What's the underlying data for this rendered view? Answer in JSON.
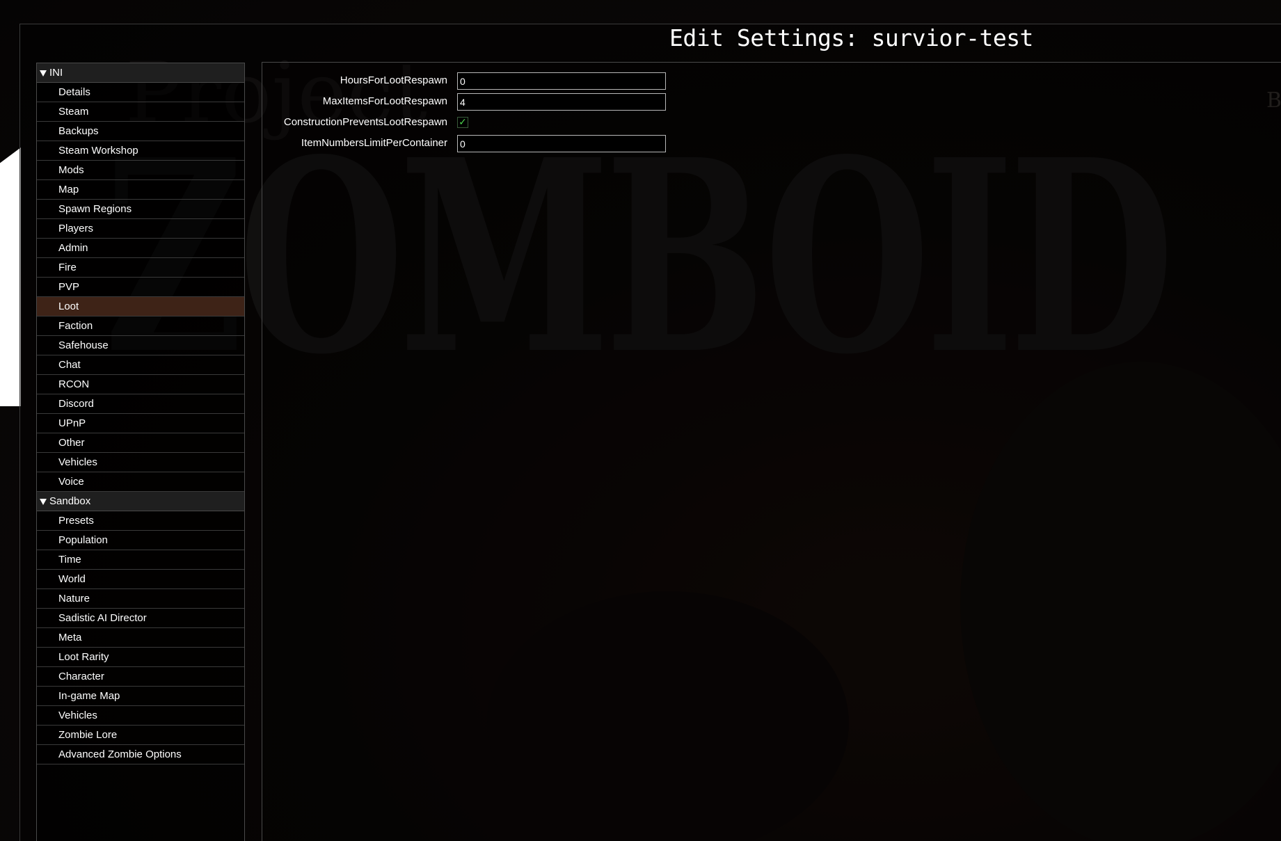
{
  "window": {
    "title": "Edit Settings: survior-test"
  },
  "background": {
    "art_sub": "Project",
    "art_title": "ZOMBOID",
    "right_fragment": "B"
  },
  "sidebar": {
    "sections": [
      {
        "label": "INI",
        "expanded": true,
        "items": [
          "Details",
          "Steam",
          "Backups",
          "Steam Workshop",
          "Mods",
          "Map",
          "Spawn Regions",
          "Players",
          "Admin",
          "Fire",
          "PVP",
          "Loot",
          "Faction",
          "Safehouse",
          "Chat",
          "RCON",
          "Discord",
          "UPnP",
          "Other",
          "Vehicles",
          "Voice"
        ]
      },
      {
        "label": "Sandbox",
        "expanded": true,
        "items": [
          "Presets",
          "Population",
          "Time",
          "World",
          "Nature",
          "Sadistic AI Director",
          "Meta",
          "Loot Rarity",
          "Character",
          "In-game Map",
          "Vehicles",
          "Zombie Lore",
          "Advanced Zombie Options"
        ]
      }
    ],
    "selected": "Loot"
  },
  "settings": [
    {
      "label": "HoursForLootRespawn",
      "type": "text",
      "value": "0"
    },
    {
      "label": "MaxItemsForLootRespawn",
      "type": "text",
      "value": "4"
    },
    {
      "label": "ConstructionPreventsLootRespawn",
      "type": "checkbox",
      "checked": true,
      "mark": "✓"
    },
    {
      "label": "ItemNumbersLimitPerContainer",
      "type": "text",
      "value": "0"
    }
  ],
  "colors": {
    "selected_row": "#3e2317",
    "header_row": "#1f1f1f",
    "check": "#4cd24c"
  }
}
